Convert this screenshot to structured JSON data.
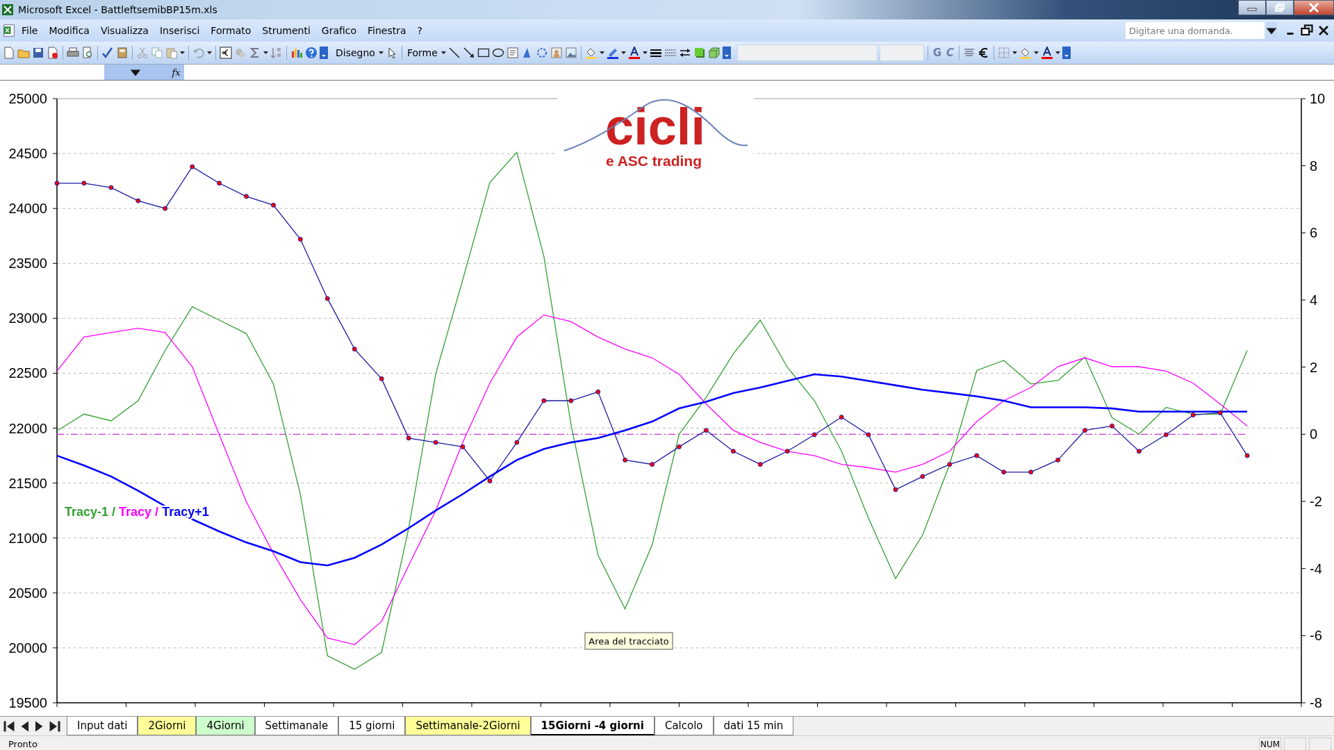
{
  "window": {
    "title": "Microsoft Excel - BattleftsemibBP15m.xls"
  },
  "menu": [
    {
      "label": "File"
    },
    {
      "label": "Modifica"
    },
    {
      "label": "Visualizza"
    },
    {
      "label": "Inserisci"
    },
    {
      "label": "Formato"
    },
    {
      "label": "Strumenti"
    },
    {
      "label": "Grafico"
    },
    {
      "label": "Finestra"
    },
    {
      "label": "?"
    }
  ],
  "help_search": {
    "placeholder": "Digitare una domanda."
  },
  "toolbar": {
    "drawing_menu": "Disegno",
    "shapes_menu": "Forme",
    "bold": "G",
    "italic": "C"
  },
  "formula_bar": {
    "function_label": "fx"
  },
  "chart": {
    "logo": {
      "title": "cicli",
      "subtitle": "e ASC trading"
    },
    "legend_separator": "/",
    "tooltip": "Area del tracciato",
    "series_styles": [
      {
        "kind": "line"
      },
      {
        "kind": "line"
      },
      {
        "kind": "bold"
      },
      {
        "kind": "line"
      },
      {
        "kind": "line"
      }
    ],
    "chart_data": {
      "type": "line",
      "grid": true,
      "ylim": [
        19500,
        25000
      ],
      "yticks": [
        19500,
        20000,
        20500,
        21000,
        21500,
        22000,
        22500,
        23000,
        23500,
        24000,
        24500,
        25000
      ],
      "y2lim": [
        -8,
        10
      ],
      "y2ticks": [
        -8,
        -6,
        -4,
        -2,
        0,
        2,
        4,
        6,
        8,
        10
      ],
      "series": [
        {
          "name": "Tracy-1",
          "color": "#33a033",
          "axis": "y2",
          "values": [
            0.1,
            0.6,
            0.4,
            1.0,
            2.5,
            3.8,
            3.4,
            3.0,
            1.5,
            -1.8,
            -6.6,
            -7.0,
            -6.5,
            -2.8,
            1.8,
            4.6,
            7.5,
            8.4,
            5.3,
            0.3,
            -3.6,
            -5.2,
            -3.3,
            0.0,
            1.1,
            2.4,
            3.4,
            2.0,
            1.0,
            -0.5,
            -2.5,
            -4.3,
            -3.0,
            -0.9,
            1.9,
            2.2,
            1.5,
            1.6,
            2.3,
            0.5,
            0.0,
            0.8,
            0.6,
            0.6,
            2.5
          ]
        },
        {
          "name": "Tracy",
          "color": "#ff00ff",
          "values": [
            22520,
            22830,
            22870,
            22910,
            22870,
            22560,
            21940,
            21330,
            20860,
            20440,
            20090,
            20030,
            20240,
            20750,
            21250,
            21870,
            22410,
            22830,
            23030,
            22970,
            22830,
            22720,
            22640,
            22490,
            22220,
            21980,
            21870,
            21790,
            21750,
            21670,
            21640,
            21600,
            21670,
            21790,
            22060,
            22250,
            22370,
            22560,
            22640,
            22560,
            22560,
            22520,
            22410,
            22220,
            22020
          ]
        },
        {
          "name": "Tracy+1",
          "color": "#0000ff",
          "values": [
            21750,
            21660,
            21560,
            21430,
            21290,
            21170,
            21060,
            20960,
            20880,
            20780,
            20750,
            20820,
            20940,
            21090,
            21250,
            21400,
            21560,
            21710,
            21810,
            21870,
            21910,
            21980,
            22060,
            22180,
            22240,
            22320,
            22370,
            22430,
            22490,
            22470,
            22430,
            22390,
            22350,
            22320,
            22290,
            22250,
            22190,
            22190,
            22190,
            22180,
            22150,
            22150,
            22150,
            22150,
            22150
          ]
        },
        {
          "color": "#1a1aa0",
          "marker": "circle",
          "values": [
            24230,
            24230,
            24190,
            24070,
            24000,
            24380,
            24230,
            24110,
            24030,
            23720,
            23180,
            22720,
            22450,
            21910,
            21870,
            21830,
            21520,
            21870,
            22250,
            22250,
            22330,
            21710,
            21670,
            21830,
            21980,
            21790,
            21670,
            21790,
            21940,
            22100,
            21940,
            21440,
            21560,
            21670,
            21750,
            21600,
            21600,
            21710,
            21980,
            22020,
            21790,
            21940,
            22120,
            22140,
            21750
          ]
        },
        {
          "color": "#cc33cc",
          "axis": "y2",
          "line_style": "dashed",
          "values": [
            0,
            0,
            0,
            0,
            0,
            0,
            0,
            0,
            0,
            0,
            0,
            0,
            0,
            0,
            0,
            0,
            0,
            0,
            0,
            0,
            0,
            0,
            0,
            0,
            0,
            0,
            0,
            0,
            0,
            0,
            0,
            0,
            0,
            0,
            0,
            0,
            0,
            0,
            0,
            0,
            0,
            0,
            0,
            0,
            0
          ]
        }
      ]
    }
  },
  "sheet_tabs": [
    {
      "label": "Input dati",
      "color": "#ffffff",
      "selected": false
    },
    {
      "label": "2Giorni",
      "color": "#ffff99",
      "selected": false
    },
    {
      "label": "4Giorni",
      "color": "#ccffcc",
      "selected": false
    },
    {
      "label": "Settimanale",
      "color": "#ffffff",
      "selected": false
    },
    {
      "label": "15 giorni",
      "color": "#ffffff",
      "selected": false
    },
    {
      "label": "Settimanale-2Giorni",
      "color": "#ffff99",
      "selected": false
    },
    {
      "label": "15Giorni -4 giorni",
      "color": "#ffffff",
      "selected": true
    },
    {
      "label": "Calcolo",
      "color": "#ffffff",
      "selected": false
    },
    {
      "label": "dati 15 min",
      "color": "#ffffff",
      "selected": false
    }
  ],
  "status_bar": {
    "message": "Pronto",
    "indicators": [
      "NUM"
    ]
  }
}
